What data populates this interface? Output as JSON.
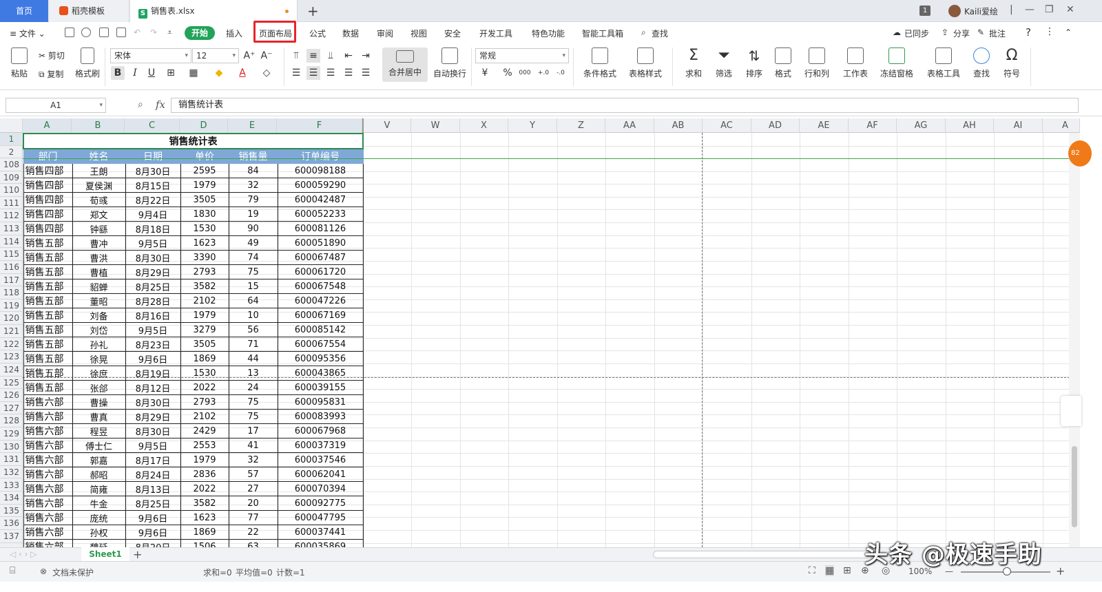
{
  "tabs": {
    "home": "首页",
    "docer": "稻壳模板",
    "file": "销售表.xlsx",
    "new_tab": "+"
  },
  "titlebar": {
    "badge": "1",
    "user": "Kaili爱绘",
    "min": "—",
    "restore": "❐",
    "close": "✕"
  },
  "menu": {
    "file": "≡ 文件 ⌄",
    "items": [
      "开始",
      "插入",
      "页面布局",
      "公式",
      "数据",
      "审阅",
      "视图",
      "安全",
      "开发工具",
      "特色功能",
      "智能工具箱"
    ],
    "search": "查找",
    "sync": "已同步",
    "share": "分享",
    "comment": "批注",
    "help": "?",
    "more": "⋮",
    "collapse": "⌃",
    "highlighted": "页面布局"
  },
  "ribbon": {
    "paste": "粘贴",
    "cut": "剪切",
    "copy": "复制",
    "format_painter": "格式刷",
    "font_name": "宋体",
    "font_size": "12",
    "bold": "B",
    "italic": "I",
    "underline": "U",
    "grow_font": "A⁺",
    "shrink_font": "A⁻",
    "merge_center": "合并居中",
    "wrap_text": "自动换行",
    "number_format": "常规",
    "currency": "¥",
    "percent": "%",
    "thousands": "000",
    "inc_decimal": "+.0",
    "dec_decimal": "-.0",
    "conditional_format": "条件格式",
    "table_style": "表格样式",
    "sum": "求和",
    "filter": "筛选",
    "sort": "排序",
    "format": "格式",
    "rows_cols": "行和列",
    "worksheet": "工作表",
    "freeze": "冻结窗格",
    "table_tools": "表格工具",
    "find": "查找",
    "symbol": "符号"
  },
  "formula_bar": {
    "name_box": "A1",
    "fx": "fx",
    "content": "销售统计表"
  },
  "columns": [
    "A",
    "B",
    "C",
    "D",
    "E",
    "F",
    "V",
    "W",
    "X",
    "Y",
    "Z",
    "AA",
    "AB",
    "AC",
    "AD",
    "AE",
    "AF",
    "AG",
    "AH",
    "AI",
    "A"
  ],
  "sheet": {
    "title": "销售统计表",
    "headers": [
      "部门",
      "姓名",
      "日期",
      "单价",
      "销售量",
      "订单编号"
    ],
    "rows": [
      [
        "108",
        "销售四部",
        "王朗",
        "8月30日",
        "2595",
        "84",
        "600098188"
      ],
      [
        "109",
        "销售四部",
        "夏侯渊",
        "8月15日",
        "1979",
        "32",
        "600059290"
      ],
      [
        "110",
        "销售四部",
        "荀彧",
        "8月22日",
        "3505",
        "79",
        "600042487"
      ],
      [
        "111",
        "销售四部",
        "郑文",
        "9月4日",
        "1830",
        "19",
        "600052233"
      ],
      [
        "112",
        "销售四部",
        "钟繇",
        "8月18日",
        "1530",
        "90",
        "600081126"
      ],
      [
        "113",
        "销售五部",
        "曹冲",
        "9月5日",
        "1623",
        "49",
        "600051890"
      ],
      [
        "114",
        "销售五部",
        "曹洪",
        "8月30日",
        "3390",
        "74",
        "600067487"
      ],
      [
        "115",
        "销售五部",
        "曹植",
        "8月29日",
        "2793",
        "75",
        "600061720"
      ],
      [
        "116",
        "销售五部",
        "貂蝉",
        "8月25日",
        "3582",
        "15",
        "600067548"
      ],
      [
        "117",
        "销售五部",
        "董昭",
        "8月28日",
        "2102",
        "64",
        "600047226"
      ],
      [
        "118",
        "销售五部",
        "刘备",
        "8月16日",
        "1979",
        "10",
        "600067169"
      ],
      [
        "119",
        "销售五部",
        "刘岱",
        "9月5日",
        "3279",
        "56",
        "600085142"
      ],
      [
        "120",
        "销售五部",
        "孙礼",
        "8月23日",
        "3505",
        "71",
        "600067554"
      ],
      [
        "121",
        "销售五部",
        "徐晃",
        "9月6日",
        "1869",
        "44",
        "600095356"
      ],
      [
        "122",
        "销售五部",
        "徐庶",
        "8月19日",
        "1530",
        "13",
        "600043865"
      ],
      [
        "123",
        "销售五部",
        "张郃",
        "8月12日",
        "2022",
        "24",
        "600039155"
      ],
      [
        "124",
        "销售六部",
        "曹操",
        "8月30日",
        "2793",
        "75",
        "600095831"
      ],
      [
        "125",
        "销售六部",
        "曹真",
        "8月29日",
        "2102",
        "75",
        "600083993"
      ],
      [
        "126",
        "销售六部",
        "程昱",
        "8月30日",
        "2429",
        "17",
        "600067968"
      ],
      [
        "127",
        "销售六部",
        "傅士仁",
        "9月5日",
        "2553",
        "41",
        "600037319"
      ],
      [
        "128",
        "销售六部",
        "郭嘉",
        "8月17日",
        "1979",
        "32",
        "600037546"
      ],
      [
        "129",
        "销售六部",
        "郝昭",
        "8月24日",
        "2836",
        "57",
        "600062041"
      ],
      [
        "130",
        "销售六部",
        "简雍",
        "8月13日",
        "2022",
        "27",
        "600070394"
      ],
      [
        "131",
        "销售六部",
        "牛金",
        "8月25日",
        "3582",
        "20",
        "600092775"
      ],
      [
        "132",
        "销售六部",
        "庞统",
        "9月6日",
        "1623",
        "77",
        "600047795"
      ],
      [
        "133",
        "销售六部",
        "孙权",
        "9月6日",
        "1869",
        "22",
        "600037441"
      ],
      [
        "134",
        "销售六部",
        "魏延",
        "8月20日",
        "1506",
        "63",
        "600035869"
      ]
    ],
    "empty_rows": [
      "135",
      "136",
      "137"
    ]
  },
  "side_badge": "82",
  "sheet_tabs": {
    "sheet1": "Sheet1",
    "add": "+",
    "nav": "◁ ‹ › ▷"
  },
  "status": {
    "protect": "文档未保护",
    "sum": "求和=0",
    "avg": "平均值=0",
    "count": "计数=1",
    "zoom": "100%",
    "zoom_out": "—",
    "zoom_in": "+"
  },
  "watermark": "头条 @极速手助"
}
